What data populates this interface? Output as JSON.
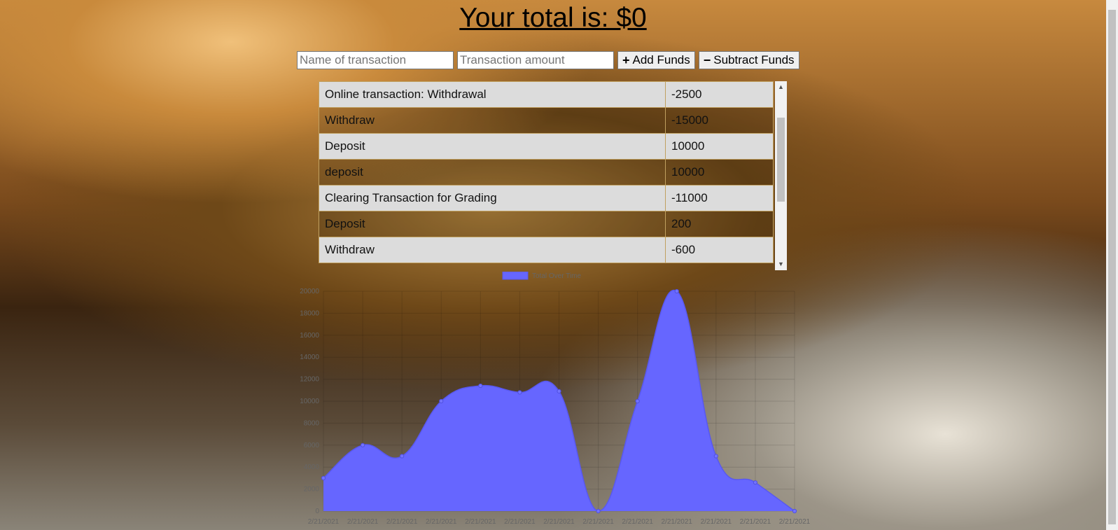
{
  "header": {
    "total_text": "Your total is: $0"
  },
  "form": {
    "name_placeholder": "Name of transaction",
    "amount_placeholder": "Transaction amount",
    "add_label": "Add Funds",
    "subtract_label": "Subtract Funds"
  },
  "transactions": [
    {
      "name": "Online transaction: Withdrawal",
      "amount": "-2500"
    },
    {
      "name": "Withdraw",
      "amount": "-15000"
    },
    {
      "name": "Deposit",
      "amount": "10000"
    },
    {
      "name": "deposit",
      "amount": "10000"
    },
    {
      "name": "Clearing Transaction for Grading",
      "amount": "-11000"
    },
    {
      "name": "Deposit",
      "amount": "200"
    },
    {
      "name": "Withdraw",
      "amount": "-600"
    }
  ],
  "chart_data": {
    "type": "area",
    "legend": "Total Over Time",
    "legend_color": "#6666ff",
    "x": [
      "2/21/2021",
      "2/21/2021",
      "2/21/2021",
      "2/21/2021",
      "2/21/2021",
      "2/21/2021",
      "2/21/2021",
      "2/21/2021",
      "2/21/2021",
      "2/21/2021",
      "2/21/2021",
      "2/21/2021",
      "2/21/2021"
    ],
    "values": [
      3000,
      6000,
      5000,
      10000,
      11400,
      10800,
      10900,
      0,
      10000,
      20000,
      5000,
      2600,
      0
    ],
    "ylim": [
      0,
      20000
    ],
    "yticks": [
      0,
      2000,
      4000,
      6000,
      8000,
      10000,
      12000,
      14000,
      16000,
      18000,
      20000
    ],
    "grid": true
  }
}
